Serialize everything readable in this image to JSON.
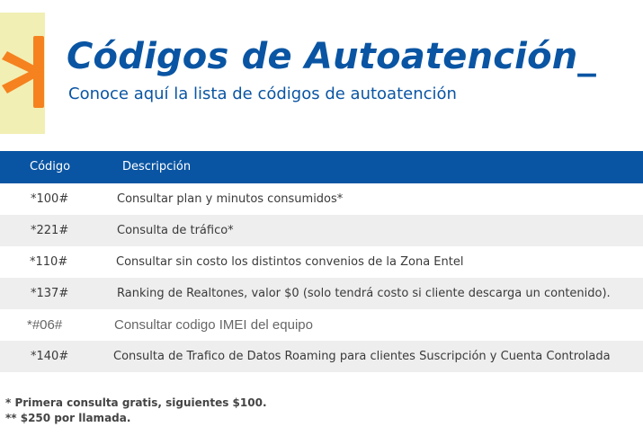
{
  "header": {
    "title": "Códigos de Autoatención_",
    "subtitle": "Conoce aquí la lista de códigos de autoatención",
    "logo_icon": "asterisk-logo-icon",
    "colors": {
      "brand_blue": "#0a55a3",
      "logo_orange": "#f5821f",
      "logo_bg": "#f1efb4"
    }
  },
  "table": {
    "columns": [
      "Código",
      "Descripción"
    ],
    "rows": [
      {
        "code": "*100#",
        "description": "Consultar plan y minutos consumidos*"
      },
      {
        "code": "*221#",
        "description": "Consulta de tráfico*"
      },
      {
        "code": "*110#",
        "description": "Consultar sin costo los distintos convenios de la Zona Entel"
      },
      {
        "code": "*137#",
        "description": "Ranking de Realtones, valor $0 (solo tendrá costo si cliente descarga un contenido)."
      },
      {
        "code": "*#06#",
        "description": "Consultar codigo IMEI del equipo"
      },
      {
        "code": "*140#",
        "description": "Consulta de Trafico de Datos Roaming para clientes Suscripción y Cuenta Controlada"
      }
    ]
  },
  "notes": [
    "* Primera consulta gratis, siguientes $100.",
    "** $250 por llamada."
  ]
}
